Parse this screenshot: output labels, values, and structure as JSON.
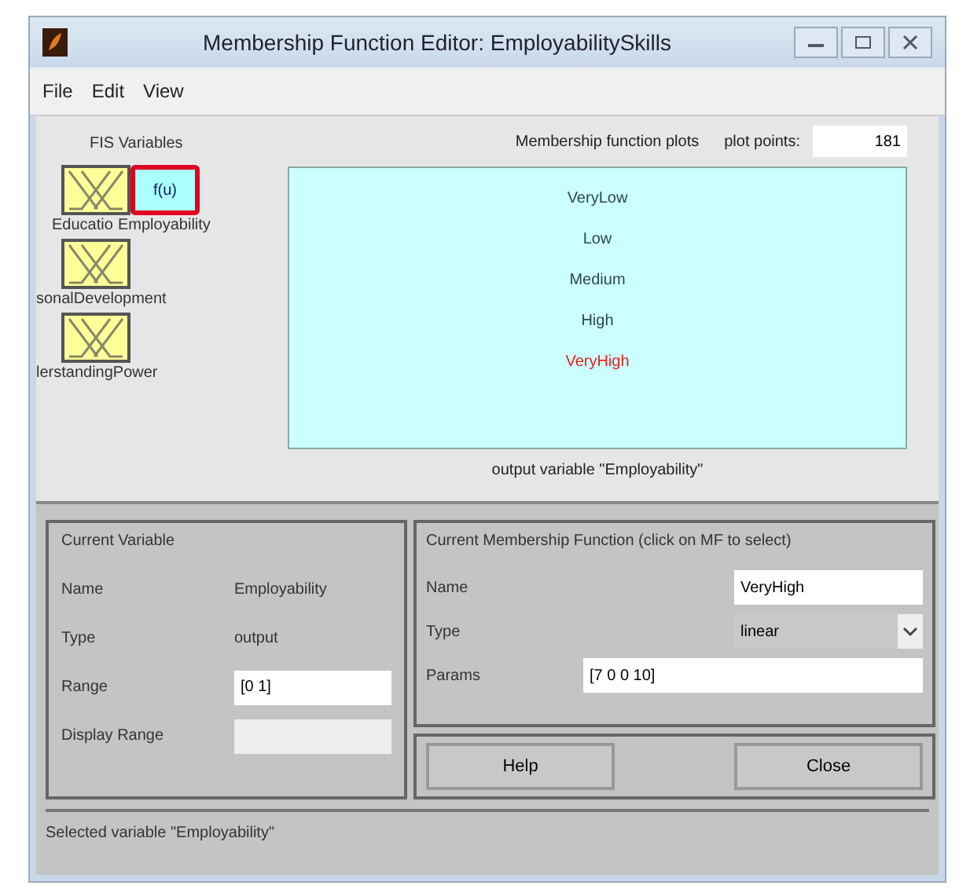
{
  "window": {
    "title": "Membership Function Editor: EmployabilitySkills"
  },
  "menu": [
    "File",
    "Edit",
    "View"
  ],
  "fis_variables": {
    "title": "FIS Variables",
    "items": [
      {
        "kind": "input",
        "label": "Educatio",
        "selected": false
      },
      {
        "kind": "output",
        "label": "Employability",
        "icon_text": "f(u)",
        "selected": true
      },
      {
        "kind": "input",
        "label": "sonalDevelopment",
        "selected": false
      },
      {
        "kind": "input",
        "label": "lerstandingPower",
        "selected": false
      }
    ]
  },
  "plot": {
    "title": "Membership function plots",
    "plot_points_label": "plot points:",
    "plot_points": "181",
    "mfs": [
      {
        "label": "VeryLow",
        "selected": false
      },
      {
        "label": "Low",
        "selected": false
      },
      {
        "label": "Medium",
        "selected": false
      },
      {
        "label": "High",
        "selected": false
      },
      {
        "label": "VeryHigh",
        "selected": true
      }
    ],
    "caption": "output variable \"Employability\""
  },
  "current_variable": {
    "title": "Current Variable",
    "name_label": "Name",
    "name": "Employability",
    "type_label": "Type",
    "type": "output",
    "range_label": "Range",
    "range": "[0 1]",
    "display_range_label": "Display Range"
  },
  "current_mf": {
    "title": "Current Membership Function (click on MF to select)",
    "name_label": "Name",
    "name": "VeryHigh",
    "type_label": "Type",
    "type": "linear",
    "params_label": "Params",
    "params": "[7 0 0 10]"
  },
  "buttons": [
    "Help",
    "Close"
  ],
  "status": "Selected variable \"Employability\""
}
